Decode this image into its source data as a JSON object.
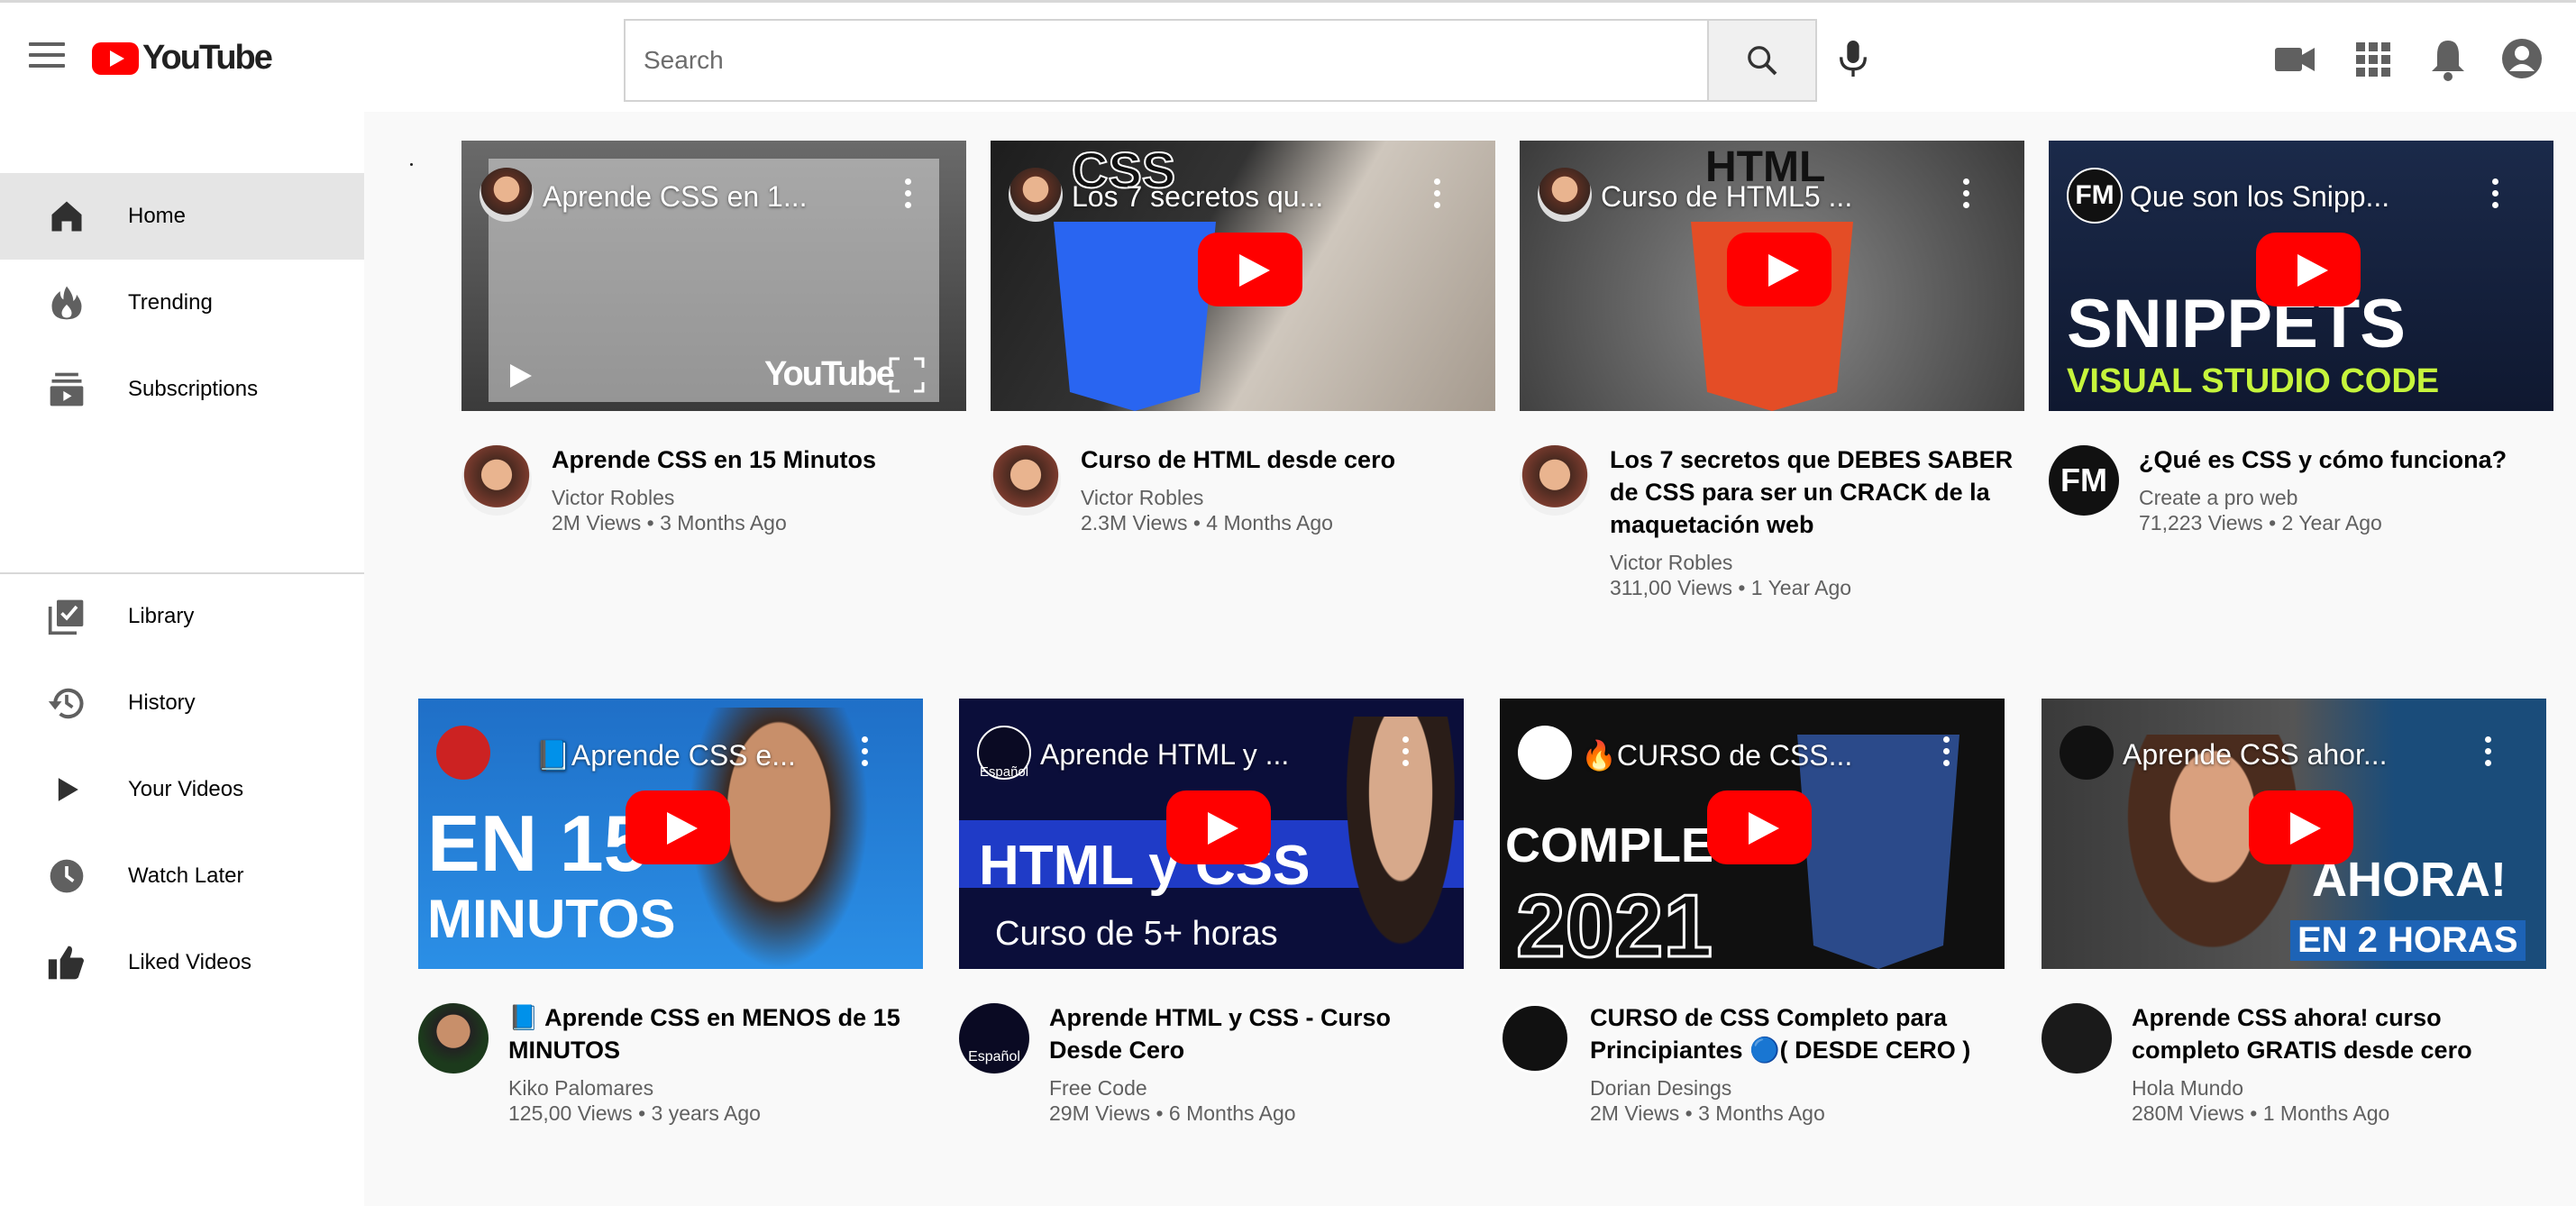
{
  "header": {
    "logo_text": "YouTube",
    "search_placeholder": "Search",
    "icons": [
      "menu-icon",
      "search-icon",
      "mic-icon",
      "video-camera-icon",
      "apps-grid-icon",
      "bell-icon",
      "account-icon"
    ]
  },
  "sidebar": {
    "items": [
      {
        "label": "Home",
        "icon": "home-icon",
        "active": true
      },
      {
        "label": "Trending",
        "icon": "flame-icon"
      },
      {
        "label": "Subscriptions",
        "icon": "subscriptions-icon"
      },
      {
        "label": "Library",
        "icon": "library-icon"
      },
      {
        "label": "History",
        "icon": "history-icon"
      },
      {
        "label": "Your Videos",
        "icon": "play-icon"
      },
      {
        "label": "Watch Later",
        "icon": "clock-icon"
      },
      {
        "label": "Liked Videos",
        "icon": "thumb-up-icon"
      }
    ]
  },
  "videos": [
    {
      "thumb_title": "Aprende CSS en 1...",
      "title": "Aprende CSS en 15 Minutos",
      "channel": "Victor Robles",
      "stats": "2M Views • 3 Months Ago",
      "thumb_overlay": "YouTube"
    },
    {
      "thumb_title": "Los 7 secretos qu...",
      "title": "Curso de HTML desde cero",
      "channel": "Victor Robles",
      "stats": "2.3M Views • 4 Months Ago",
      "thumb_overlay": "CSS"
    },
    {
      "thumb_title": "Curso de HTML5 ...",
      "title": "Los 7 secretos que DEBES SABER de CSS para ser un CRACK de la maquetación web",
      "channel": "Victor Robles",
      "stats": "311,00 Views • 1 Year Ago",
      "thumb_overlay": "HTML"
    },
    {
      "thumb_title": "Que son los Snipp...",
      "title": "¿Qué es CSS y cómo funciona?",
      "channel": "Create a pro web",
      "stats": "71,223 Views • 2 Year Ago",
      "thumb_overlay": "SNIPPETS",
      "thumb_overlay2": "VISUAL STUDIO CODE",
      "avatar_text": "FM"
    },
    {
      "thumb_title": "📘Aprende CSS e...",
      "title": "📘 Aprende CSS en MENOS de 15 MINUTOS",
      "channel": "Kiko Palomares",
      "stats": "125,00 Views • 3 years Ago",
      "thumb_overlay": "EN 15",
      "thumb_overlay2": "MINUTOS"
    },
    {
      "thumb_title": "Aprende HTML y ...",
      "title": "Aprende HTML y CSS - Curso Desde Cero",
      "channel": "Free Code",
      "stats": "29M Views • 6 Months Ago",
      "thumb_overlay": "HTML y CSS",
      "thumb_overlay2": "Curso de 5+ horas",
      "avatar_text": "Español"
    },
    {
      "thumb_title": "🔥CURSO de CSS...",
      "title": "CURSO de CSS Completo para Principiantes 🔵( DESDE CERO )",
      "channel": "Dorian Desings",
      "stats": "2M Views • 3 Months Ago",
      "thumb_overlay": "COMPLE",
      "thumb_overlay2": "2021"
    },
    {
      "thumb_title": "Aprende CSS ahor...",
      "title": "Aprende CSS ahora! curso completo GRATIS desde cero",
      "channel": "Hola Mundo",
      "stats": "280M Views • 1 Months Ago",
      "thumb_overlay": "AHORA!",
      "thumb_overlay2": "EN 2 HORAS"
    }
  ],
  "colors": {
    "brand_red": "#ff0000",
    "text_primary": "#030303",
    "text_secondary": "#606060"
  }
}
